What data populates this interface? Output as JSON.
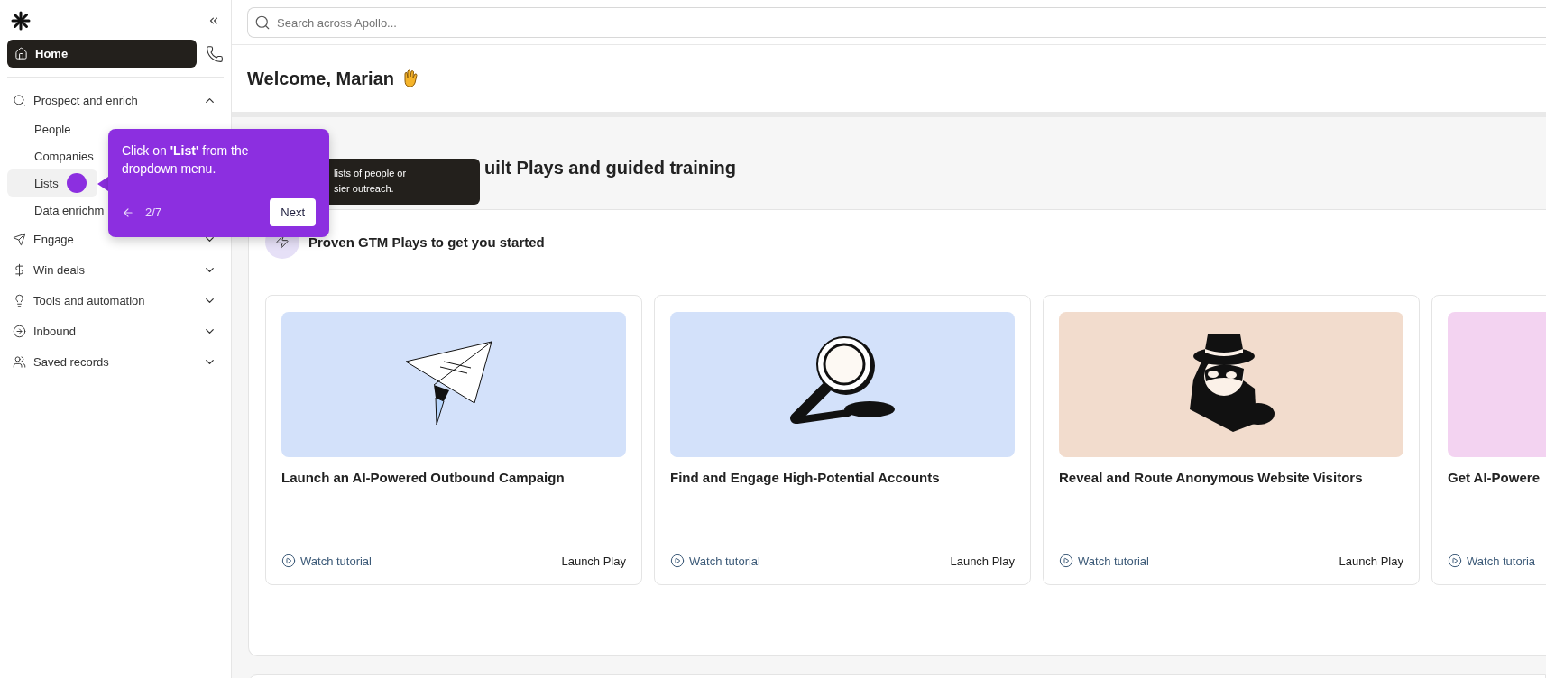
{
  "sidebar": {
    "nav": [
      {
        "kind": "home",
        "label": "Home",
        "selected": true
      },
      {
        "kind": "section",
        "label": "Prospect and enrich",
        "expanded": true,
        "children": [
          {
            "label": "People",
            "selected": false
          },
          {
            "label": "Companies",
            "selected": false
          },
          {
            "label": "Lists",
            "selected": true
          },
          {
            "label": "Data enrichm",
            "selected": false
          }
        ]
      },
      {
        "kind": "section",
        "label": "Engage",
        "expanded": false
      },
      {
        "kind": "section",
        "label": "Win deals",
        "expanded": false
      },
      {
        "kind": "section",
        "label": "Tools and automation",
        "expanded": false
      },
      {
        "kind": "section",
        "label": "Inbound",
        "expanded": false
      },
      {
        "kind": "section",
        "label": "Saved records",
        "expanded": false
      }
    ]
  },
  "search": {
    "placeholder": "Search across Apollo..."
  },
  "header": {
    "title": "Welcome, Marian"
  },
  "section_heading": "uilt Plays and guided training",
  "hover_tooltip": {
    "lines": [
      "lists of people or",
      "sier outreach."
    ]
  },
  "plays": {
    "title": "Proven GTM Plays to get you started",
    "cards": [
      {
        "kind": "plane",
        "color": "#d3e1fa",
        "title": "Launch an AI-Powered Outbound Campaign",
        "watch": "Watch tutorial",
        "launch": "Launch Play"
      },
      {
        "kind": "magnifier",
        "color": "#d3e1fa",
        "title": "Find and Engage High-Potential Accounts",
        "watch": "Watch tutorial",
        "launch": "Launch Play"
      },
      {
        "kind": "spy",
        "color": "#f2dccd",
        "title": "Reveal and Route Anonymous Website Visitors",
        "watch": "Watch tutorial",
        "launch": "Launch Play"
      },
      {
        "kind": "none",
        "color": "#f3d3f1",
        "title": "Get AI-Powere",
        "watch": "Watch tutoria"
      }
    ]
  },
  "guide": {
    "text": "Click on **'List'** from the dropdown menu.",
    "step": "2/7",
    "next": "Next"
  }
}
